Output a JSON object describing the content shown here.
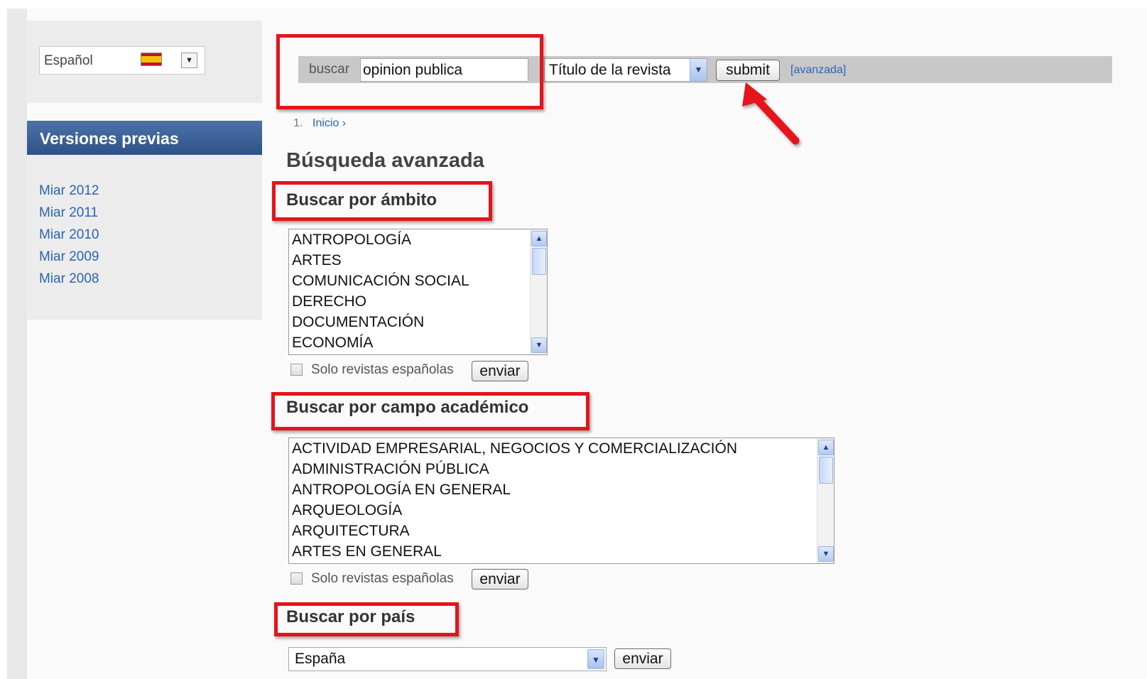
{
  "sidebar": {
    "language": {
      "selected": "Español",
      "flag": "spain-flag-icon"
    },
    "versions": {
      "title": "Versiones previas",
      "items": [
        "Miar 2012",
        "Miar 2011",
        "Miar 2010",
        "Miar 2009",
        "Miar 2008"
      ]
    }
  },
  "search": {
    "label": "buscar",
    "value": "opinion publica",
    "field": "Título de la revista",
    "submit_label": "submit",
    "advanced_link": "[avanzada]"
  },
  "breadcrumb": {
    "number": "1.",
    "label": "Inicio ›"
  },
  "page_title": "Búsqueda avanzada",
  "ambito": {
    "title": "Buscar por ámbito",
    "options": [
      "ANTROPOLOGÍA",
      "ARTES",
      "COMUNICACIÓN SOCIAL",
      "DERECHO",
      "DOCUMENTACIÓN",
      "ECONOMÍA"
    ],
    "checkbox_label": "Solo revistas españolas",
    "button_label": "enviar"
  },
  "campo": {
    "title": "Buscar por campo académico",
    "options": [
      "ACTIVIDAD EMPRESARIAL, NEGOCIOS Y COMERCIALIZACIÓN",
      "ADMINISTRACIÓN PÚBLICA",
      "ANTROPOLOGÍA EN GENERAL",
      "ARQUEOLOGÍA",
      "ARQUITECTURA",
      "ARTES EN GENERAL"
    ],
    "checkbox_label": "Solo revistas españolas",
    "button_label": "enviar"
  },
  "pais": {
    "title": "Buscar por país",
    "selected": "España",
    "button_label": "enviar"
  },
  "colors": {
    "accent": "#2e5287",
    "link": "#2b64b3",
    "annotation": "#e4141b"
  }
}
